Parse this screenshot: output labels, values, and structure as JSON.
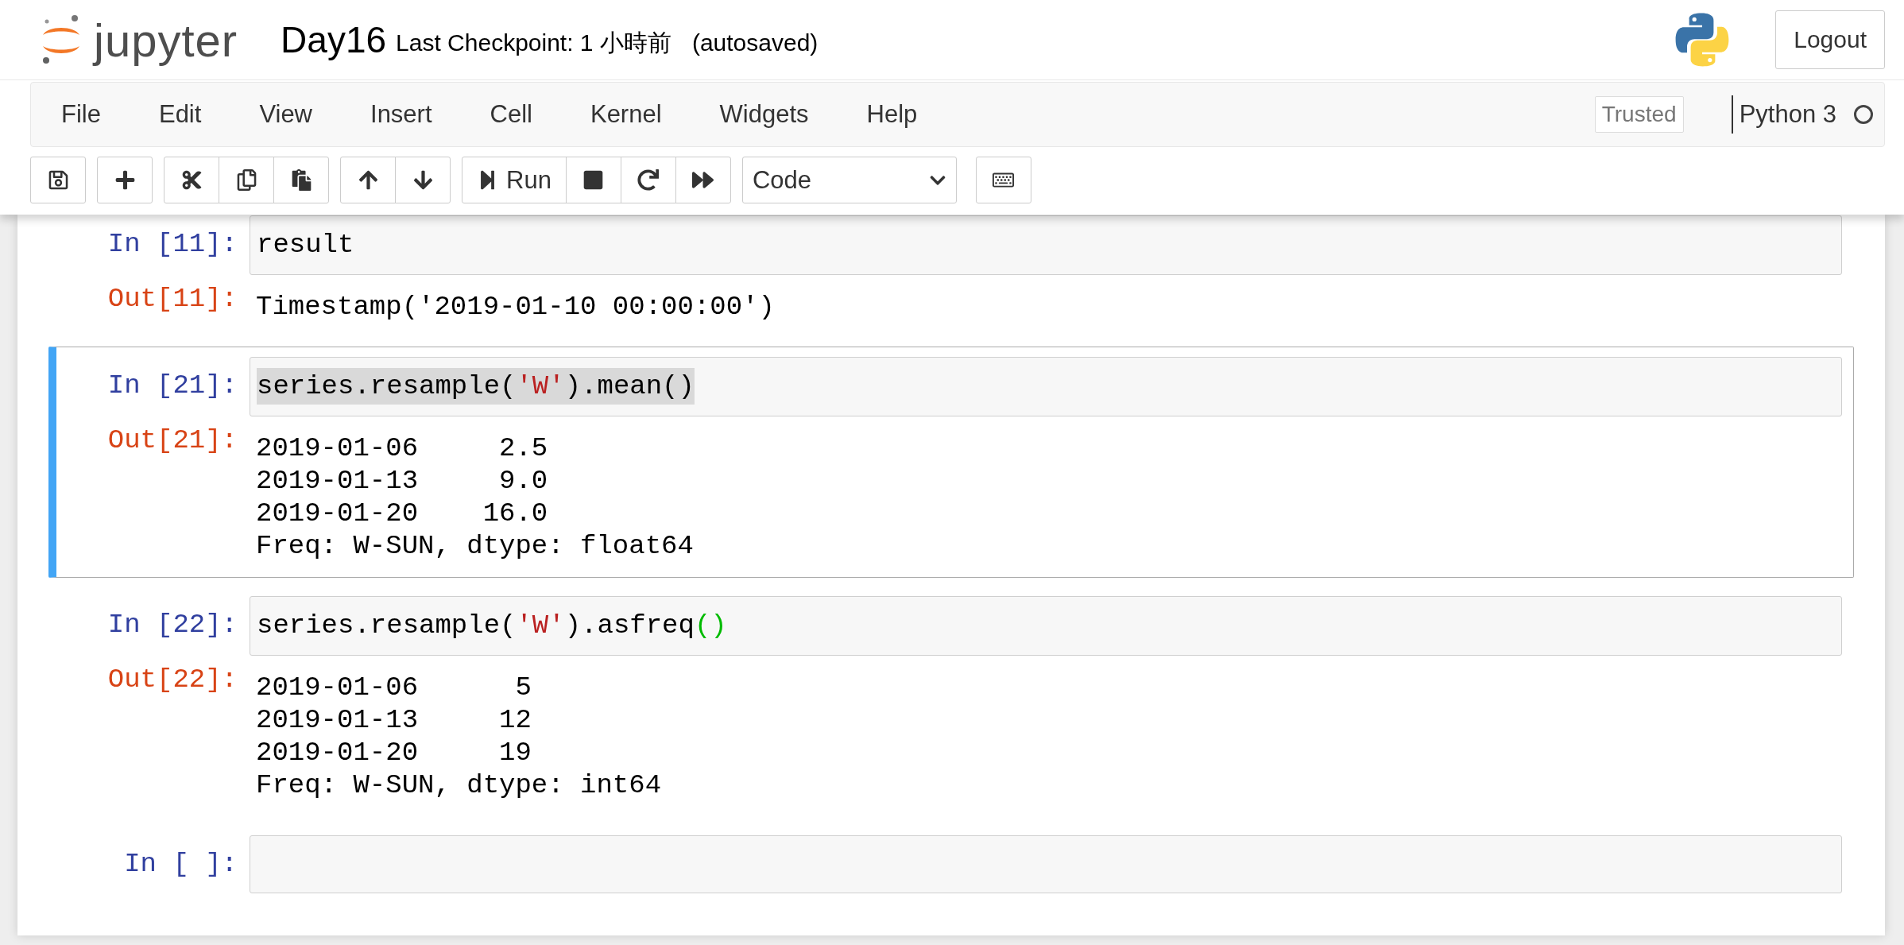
{
  "header": {
    "logo_text": "jupyter",
    "notebook_name": "Day16",
    "checkpoint": "Last Checkpoint: 1 小時前",
    "autosave": "(autosaved)",
    "logout": "Logout"
  },
  "menu": [
    {
      "label": "File"
    },
    {
      "label": "Edit"
    },
    {
      "label": "View"
    },
    {
      "label": "Insert"
    },
    {
      "label": "Cell"
    },
    {
      "label": "Kernel"
    },
    {
      "label": "Widgets"
    },
    {
      "label": "Help"
    }
  ],
  "trusted": "Trusted",
  "kernel": {
    "name": "Python 3",
    "busy": false
  },
  "toolbar": {
    "run_label": "Run",
    "cell_type": "Code"
  },
  "cells": [
    {
      "prompt": "In [11]:",
      "selected": false,
      "code": [
        {
          "kind": "plain",
          "text": "result"
        }
      ],
      "output": {
        "prompt": "Out[11]:",
        "lines": [
          "Timestamp('2019-01-10 00:00:00')"
        ]
      }
    },
    {
      "prompt": "In [21]:",
      "selected": true,
      "text_highlighted": true,
      "code": [
        {
          "kind": "plain",
          "text": "series.resample("
        },
        {
          "kind": "string",
          "text": "'W'"
        },
        {
          "kind": "plain",
          "text": ").mean()"
        }
      ],
      "output": {
        "prompt": "Out[21]:",
        "lines": [
          "2019-01-06     2.5",
          "2019-01-13     9.0",
          "2019-01-20    16.0",
          "Freq: W-SUN, dtype: float64"
        ]
      }
    },
    {
      "prompt": "In [22]:",
      "selected": false,
      "code": [
        {
          "kind": "plain",
          "text": "series.resample("
        },
        {
          "kind": "string",
          "text": "'W'"
        },
        {
          "kind": "plain",
          "text": ").asfreq"
        },
        {
          "kind": "bracket",
          "text": "()"
        }
      ],
      "output": {
        "prompt": "Out[22]:",
        "lines": [
          "2019-01-06      5",
          "2019-01-13     12",
          "2019-01-20     19",
          "Freq: W-SUN, dtype: int64"
        ]
      }
    },
    {
      "prompt": "In [ ]:",
      "selected": false
    }
  ]
}
